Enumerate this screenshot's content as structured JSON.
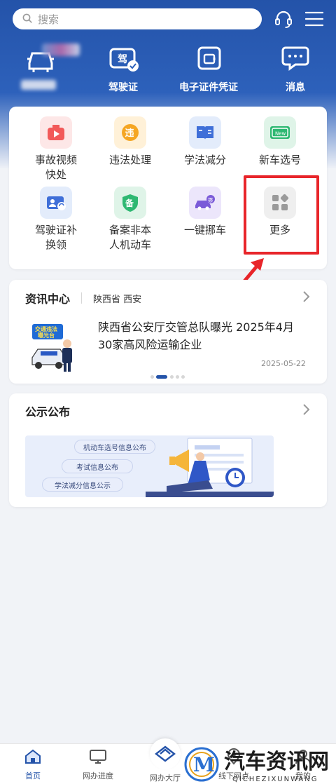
{
  "header": {
    "search_placeholder": "搜索",
    "icons": [
      "headset-icon",
      "menu-icon"
    ]
  },
  "quick_actions": [
    {
      "label": "驾驶证",
      "icon": "driver-license-icon"
    },
    {
      "label": "电子证件凭证",
      "icon": "e-certificate-icon"
    },
    {
      "label": "消息",
      "icon": "message-icon"
    }
  ],
  "services": [
    {
      "label": "事故视频\n快处",
      "icon": "accident-video-icon",
      "color": "#f25a5a"
    },
    {
      "label": "违法处理",
      "icon": "violation-icon",
      "color": "#f5a623"
    },
    {
      "label": "学法减分",
      "icon": "study-book-icon",
      "color": "#3f6fd8"
    },
    {
      "label": "新车选号",
      "icon": "new-plate-icon",
      "color": "#2eb872"
    },
    {
      "label": "驾驶证补\n换领",
      "icon": "license-replace-icon",
      "color": "#3f6fd8"
    },
    {
      "label": "备案非本\n人机动车",
      "icon": "record-shield-icon",
      "color": "#2eb872"
    },
    {
      "label": "一键挪车",
      "icon": "move-car-icon",
      "color": "#7b5bd8"
    },
    {
      "label": "更多",
      "icon": "more-apps-icon",
      "color": "#9a9a9a"
    }
  ],
  "news": {
    "title": "资讯中心",
    "region": "陕西省 西安",
    "headline": "陕西省公安厅交管总队曝光 2025年4月30家高风险运输企业",
    "date": "2025-05-22",
    "thumb_text": "交通违法曝光台"
  },
  "notice": {
    "title": "公示公布",
    "pills": [
      "机动车选号信息公布",
      "考试信息公布",
      "学法减分信息公示"
    ]
  },
  "tabbar": {
    "tabs": [
      {
        "label": "首页",
        "icon": "home-icon",
        "active": true
      },
      {
        "label": "网办进度",
        "icon": "monitor-icon",
        "active": false
      },
      {
        "label": "网办大厅",
        "icon": "hall-diamond-icon",
        "active": false
      },
      {
        "label": "线下网点",
        "icon": "location-icon",
        "active": false
      },
      {
        "label": "我的",
        "icon": "user-icon",
        "active": false
      }
    ]
  },
  "watermark": {
    "logo_letter": "M",
    "title": "汽车资讯网",
    "subtitle": "QICHEZIXUNWANG"
  },
  "colors": {
    "brand_blue": "#2453a9",
    "highlight_red": "#e8252a",
    "active_tab": "#2453a9"
  }
}
